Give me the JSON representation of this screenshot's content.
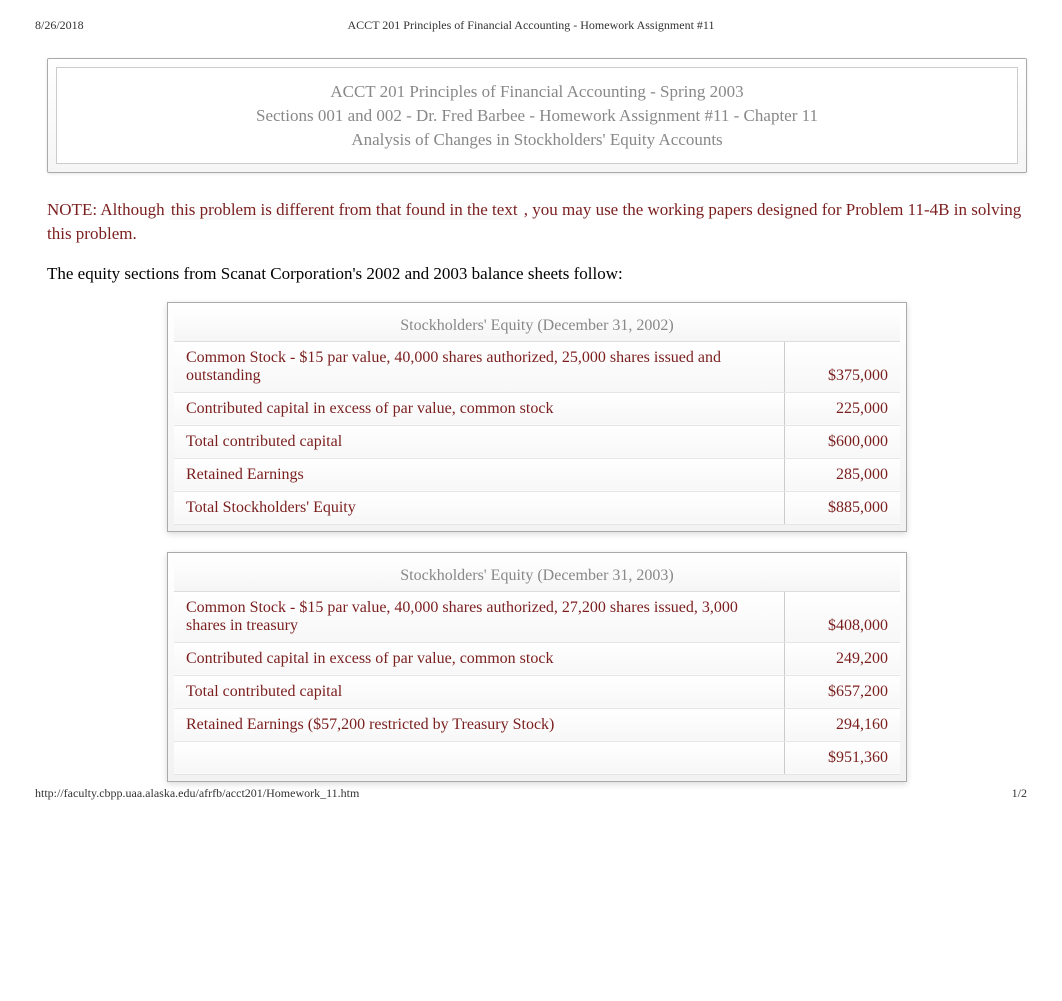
{
  "header": {
    "date": "8/26/2018",
    "title": "ACCT 201 Principles of Financial Accounting - Homework Assignment #11"
  },
  "title_box": {
    "line1": "ACCT 201 Principles of Financial Accounting - Spring 2003",
    "line2": "Sections 001 and 002 - Dr. Fred Barbee - Homework Assignment #11 - Chapter 11",
    "line3": "Analysis of Changes in Stockholders' Equity Accounts"
  },
  "note": {
    "prefix": "NOTE: Although ",
    "highlight": "this problem is different from that found in the text",
    "suffix": ", you may use the working papers designed for Problem 11-4B in solving this problem."
  },
  "intro": "The equity sections from Scanat Corporation's 2002 and 2003 balance sheets follow:",
  "equity_2002": {
    "title": "Stockholders' Equity (December 31, 2002)",
    "rows": [
      {
        "desc": "Common Stock - $15 par value, 40,000 shares authorized, 25,000 shares issued and outstanding",
        "amt": "$375,000"
      },
      {
        "desc": "Contributed capital in excess of par value, common stock",
        "amt": "225,000"
      },
      {
        "desc": "Total contributed capital",
        "amt": "$600,000"
      },
      {
        "desc": "Retained Earnings",
        "amt": "285,000"
      },
      {
        "desc": "Total Stockholders' Equity",
        "amt": "$885,000"
      }
    ]
  },
  "equity_2003": {
    "title": "Stockholders' Equity (December 31, 2003)",
    "rows": [
      {
        "desc": "Common Stock - $15 par value, 40,000 shares authorized, 27,200 shares issued, 3,000 shares in treasury",
        "amt": "$408,000"
      },
      {
        "desc": "Contributed capital in excess of par value, common stock",
        "amt": "249,200"
      },
      {
        "desc": "Total contributed capital",
        "amt": "$657,200"
      },
      {
        "desc": "Retained Earnings ($57,200 restricted by Treasury Stock)",
        "amt": "294,160"
      },
      {
        "desc": "",
        "amt": "$951,360"
      }
    ]
  },
  "footer": {
    "url": "http://faculty.cbpp.uaa.alaska.edu/afrfb/acct201/Homework_11.htm",
    "page": "1/2"
  }
}
